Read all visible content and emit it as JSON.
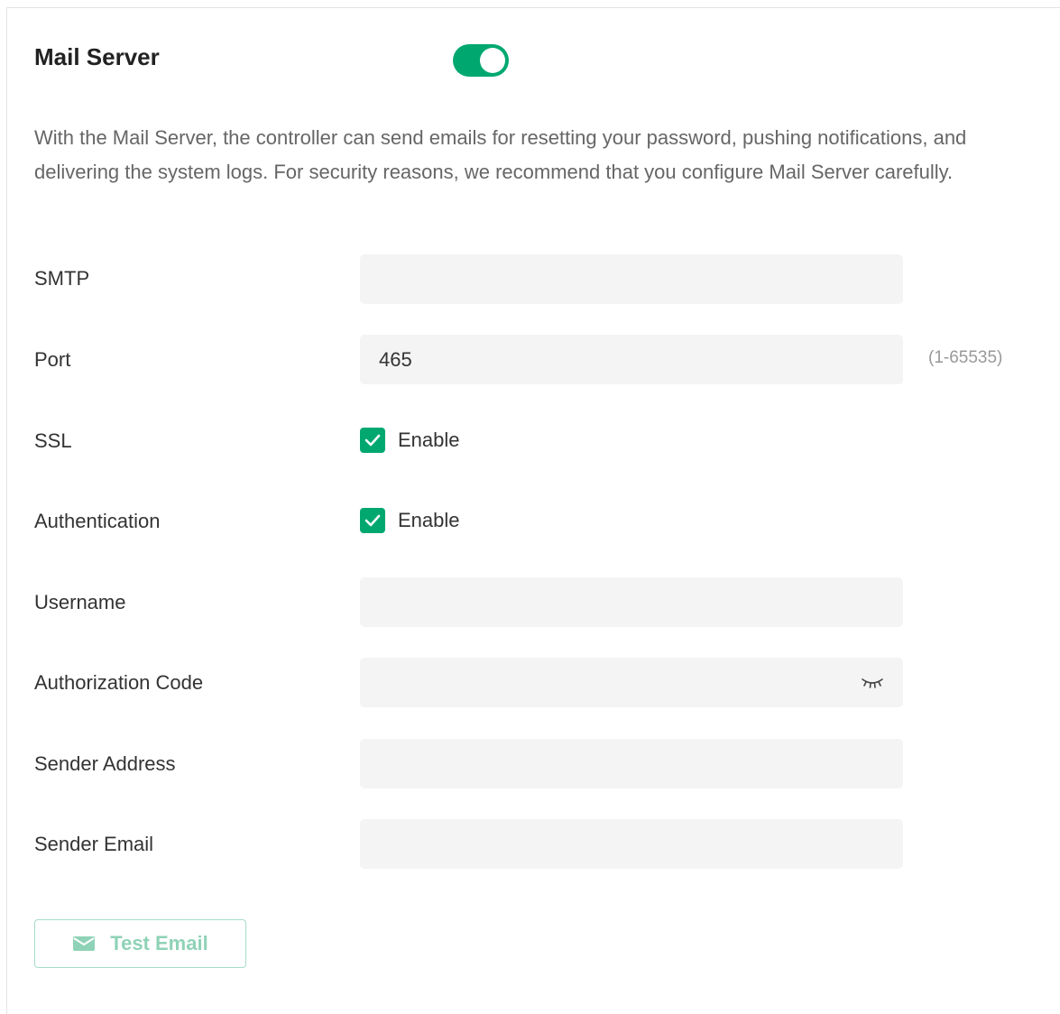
{
  "header": {
    "title": "Mail Server",
    "toggle_on": true
  },
  "description": "With the Mail Server, the controller can send emails for resetting your password, pushing notifications, and delivering the system logs. For security reasons, we recommend that you configure Mail Server carefully.",
  "form": {
    "smtp": {
      "label": "SMTP",
      "value": ""
    },
    "port": {
      "label": "Port",
      "value": "465",
      "hint": "(1-65535)"
    },
    "ssl": {
      "label": "SSL",
      "checkbox_label": "Enable",
      "checked": true
    },
    "authentication": {
      "label": "Authentication",
      "checkbox_label": "Enable",
      "checked": true
    },
    "username": {
      "label": "Username",
      "value": ""
    },
    "authorization_code": {
      "label": "Authorization Code",
      "value": ""
    },
    "sender_address": {
      "label": "Sender Address",
      "value": ""
    },
    "sender_email": {
      "label": "Sender Email",
      "value": ""
    }
  },
  "actions": {
    "test_email_label": "Test Email"
  },
  "colors": {
    "accent": "#00a870",
    "button_text_disabled": "#8fd2b7"
  },
  "icons": {
    "password_visibility": "eye-closed-icon",
    "email": "mail-icon",
    "check": "check-icon"
  }
}
